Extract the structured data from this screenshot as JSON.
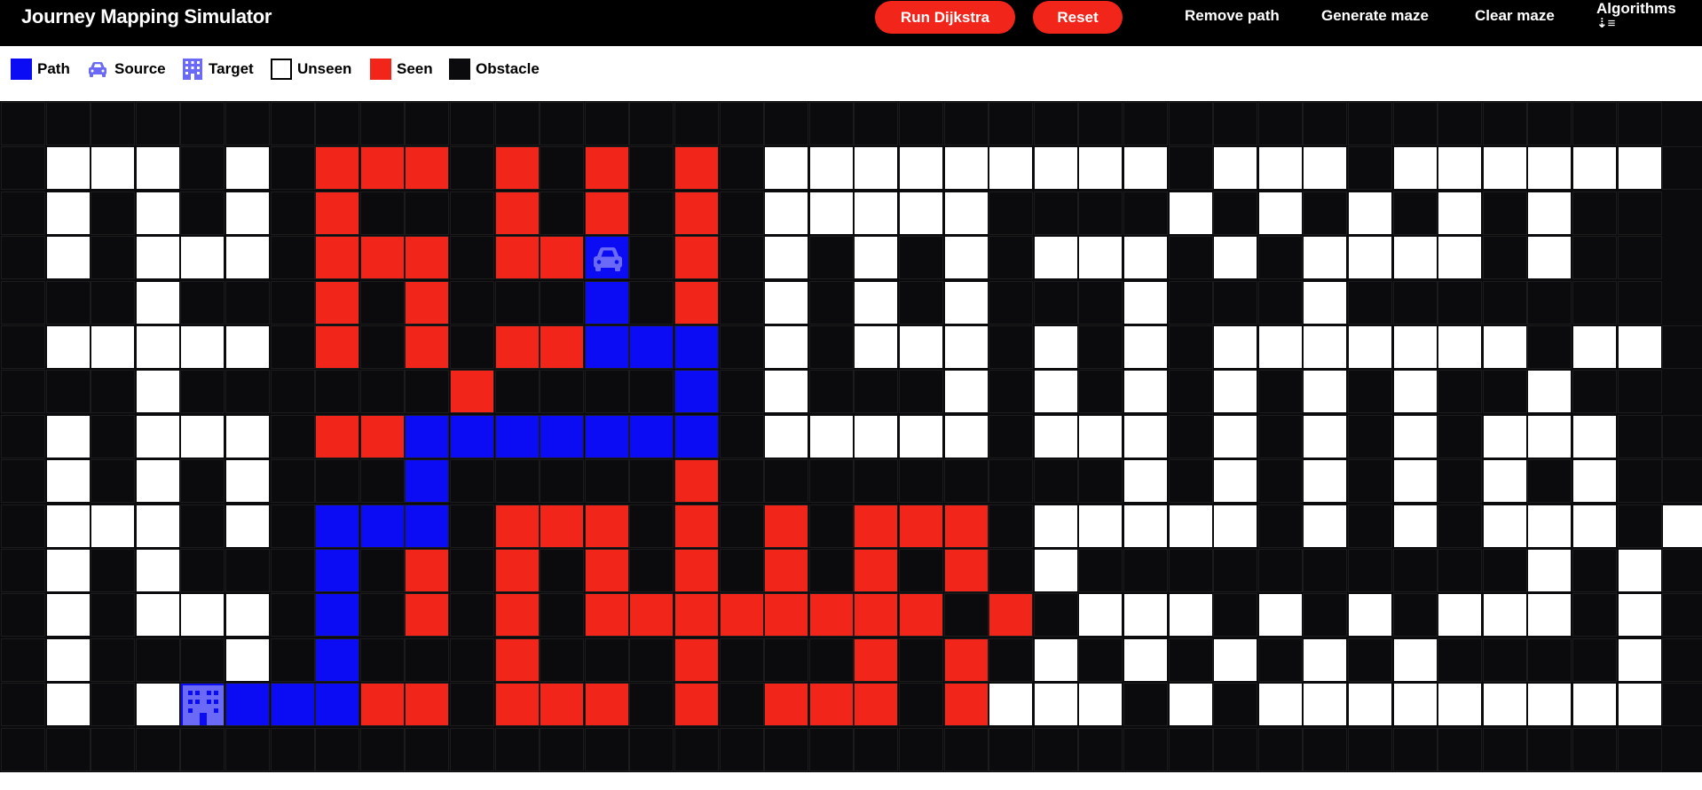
{
  "header": {
    "title": "Journey Mapping Simulator",
    "run_label": "Run Dijkstra",
    "reset_label": "Reset",
    "nav": [
      "Remove path",
      "Generate maze",
      "Clear maze"
    ],
    "algorithms_label": "Algorithms",
    "algorithms_icon": "⇣≡"
  },
  "legend": [
    {
      "label": "Path",
      "kind": "path"
    },
    {
      "label": "Source",
      "kind": "source"
    },
    {
      "label": "Target",
      "kind": "target"
    },
    {
      "label": "Unseen",
      "kind": "unseen"
    },
    {
      "label": "Seen",
      "kind": "seen"
    },
    {
      "label": "Obstacle",
      "kind": "obstacle"
    }
  ],
  "colors": {
    "path": "#0b0bf4",
    "seen": "#f2251a",
    "unseen": "#ffffff",
    "obstacle": "#0b0a0d",
    "icon": "#6a6af6",
    "accent": "#f2251a"
  },
  "grid": {
    "legend": "#=obstacle, .=unseen, R=seen, B=path, S=source, T=target",
    "rows": [
      "#####################################",
      "#...#.#RRR#R#R#R#.........#...#......#",
      "#.#.#.#R###R#R#R#.....####.#.#.#.#.##",
      "#.#...#RRR#RRS#R#.#.#.#...#.#....#.##",
      "###.###R#R###B#R#.#.#.###.###.#######",
      "#.....#R#R#RRBBB#.#...#.#.#.......#..#",
      "###.######R####B#.###.#.#.#.#.#.##.##",
      "#.#...#RRBBBBBBB#.....#...#.#.#.#...##",
      "#.#.#.###B#####R#########.#.#.#.#.#.##",
      "#...#.#BBB#RRR#R#R#RRR#.....#.#.#...#.#",
      "#.#.###B#R#R#R#R#R#R#R#.##########.#.##",
      "#.#...#B#R#R#RRRRRRRR#R#...#.#.#...#.##",
      "#.###.#B###R###R###R#R#.#.#.#.#.####.##",
      "#.#.TBBBRR#RRR#R#RRR#R...#.#.........#",
      "#####################################"
    ]
  }
}
